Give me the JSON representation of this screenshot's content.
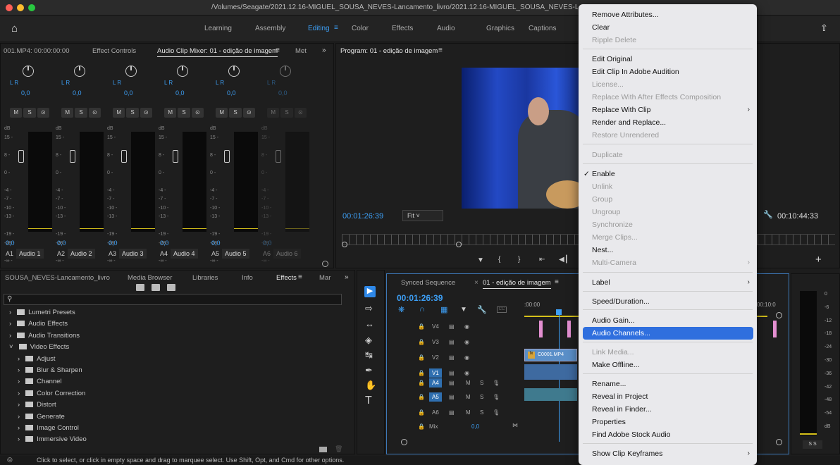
{
  "window": {
    "title": "/Volumes/Seagate/2021.12.16-MIGUEL_SOUSA_NEVES-Lancamento_livro/2021.12.16-MIGUEL_SOUSA_NEVES-Lancame"
  },
  "workspaces": [
    "Learning",
    "Assembly",
    "Editing",
    "Color",
    "Effects",
    "Audio",
    "Graphics",
    "Captions"
  ],
  "panels": {
    "source_tabs": [
      "001.MP4: 00:00:00:00",
      "Effect Controls",
      "Audio Clip Mixer: 01 - edição de imagem",
      "Met"
    ],
    "program_title": "Program: 01 - edição de imagem",
    "program_timecode": "00:01:26:39",
    "program_fit": "Fit",
    "program_duration": "00:10:44:33",
    "project_tabs": [
      "SOUSA_NEVES-Lancamento_livro",
      "Media Browser",
      "Libraries",
      "Info",
      "Effects",
      "Mar"
    ],
    "timeline_tabs": [
      "Synced Sequence",
      "01 - edição de imagem"
    ],
    "timeline_timecode": "00:01:26:39",
    "ruler_start": ":00:00",
    "ruler_end": "00:10:0",
    "mix_label": "Mix",
    "mix_value": "0,0",
    "clip_name": "C0001.MP4"
  },
  "mixer": {
    "scale": "dB\n15 -\n\n8 -\n\n0 -\n\n-4 -\n-7 -\n-10 -\n-13 -\n\n-19 -\n-28 -\n\n-∞ -",
    "lr": "L       R",
    "solo": [
      "M",
      "S",
      "⊙"
    ],
    "channels": [
      {
        "pan": "0,0",
        "value": "0,0",
        "id": "A1",
        "name": "Audio 1"
      },
      {
        "pan": "0,0",
        "value": "0,0",
        "id": "A2",
        "name": "Audio 2"
      },
      {
        "pan": "0,0",
        "value": "0,0",
        "id": "A3",
        "name": "Audio 3"
      },
      {
        "pan": "0,0",
        "value": "0,0",
        "id": "A4",
        "name": "Audio 4"
      },
      {
        "pan": "0,0",
        "value": "0,0",
        "id": "A5",
        "name": "Audio 5"
      },
      {
        "pan": "0,0",
        "value": "0,0",
        "id": "A6",
        "name": "Audio 6"
      }
    ]
  },
  "effects": [
    "Lumetri Presets",
    "Audio Effects",
    "Audio Transitions",
    "Video Effects",
    "Adjust",
    "Blur & Sharpen",
    "Channel",
    "Color Correction",
    "Distort",
    "Generate",
    "Image Control",
    "Immersive Video"
  ],
  "tracks": [
    "V4",
    "V3",
    "V2",
    "V1",
    "A4",
    "A5",
    "A6"
  ],
  "track_controls": [
    "M",
    "S"
  ],
  "audio_meter_scale": [
    "0",
    "-6",
    "-12",
    "-18",
    "-24",
    "-30",
    "-36",
    "-42",
    "-48",
    "-54",
    "dB"
  ],
  "audio_meter_solo": "S  S",
  "menu": {
    "items": [
      {
        "label": "Remove Attributes...",
        "enabled": true
      },
      {
        "label": "Clear",
        "enabled": true
      },
      {
        "label": "Ripple Delete",
        "enabled": false
      },
      {
        "label": "Edit Original",
        "enabled": true
      },
      {
        "label": "Edit Clip In Adobe Audition",
        "enabled": true
      },
      {
        "label": "License...",
        "enabled": false
      },
      {
        "label": "Replace With After Effects Composition",
        "enabled": false
      },
      {
        "label": "Replace With Clip",
        "enabled": true
      },
      {
        "label": "Render and Replace...",
        "enabled": true
      },
      {
        "label": "Restore Unrendered",
        "enabled": false
      },
      {
        "label": "Duplicate",
        "enabled": false
      },
      {
        "label": "Enable",
        "enabled": true,
        "checked": true
      },
      {
        "label": "Unlink",
        "enabled": false
      },
      {
        "label": "Group",
        "enabled": false
      },
      {
        "label": "Ungroup",
        "enabled": false
      },
      {
        "label": "Synchronize",
        "enabled": false
      },
      {
        "label": "Merge Clips...",
        "enabled": false
      },
      {
        "label": "Nest...",
        "enabled": true
      },
      {
        "label": "Multi-Camera",
        "enabled": false
      },
      {
        "label": "Label",
        "enabled": true
      },
      {
        "label": "Speed/Duration...",
        "enabled": true
      },
      {
        "label": "Audio Gain...",
        "enabled": true
      },
      {
        "label": "Audio Channels...",
        "enabled": true,
        "highlighted": true
      },
      {
        "label": "Link Media...",
        "enabled": false
      },
      {
        "label": "Make Offline...",
        "enabled": true
      },
      {
        "label": "Rename...",
        "enabled": true
      },
      {
        "label": "Reveal in Project",
        "enabled": true
      },
      {
        "label": "Reveal in Finder...",
        "enabled": true
      },
      {
        "label": "Properties",
        "enabled": true
      },
      {
        "label": "Find Adobe Stock Audio",
        "enabled": true
      },
      {
        "label": "Show Clip Keyframes",
        "enabled": true
      }
    ]
  },
  "status_bar": "Click to select, or click in empty space and drag to marquee select. Use Shift, Opt, and Cmd for other options.",
  "colors": {
    "accent": "#3d9ff5",
    "menu_highlight": "#2f6fde",
    "clip_pink": "#e48fd1",
    "clip_blue": "#5a8fc8"
  }
}
